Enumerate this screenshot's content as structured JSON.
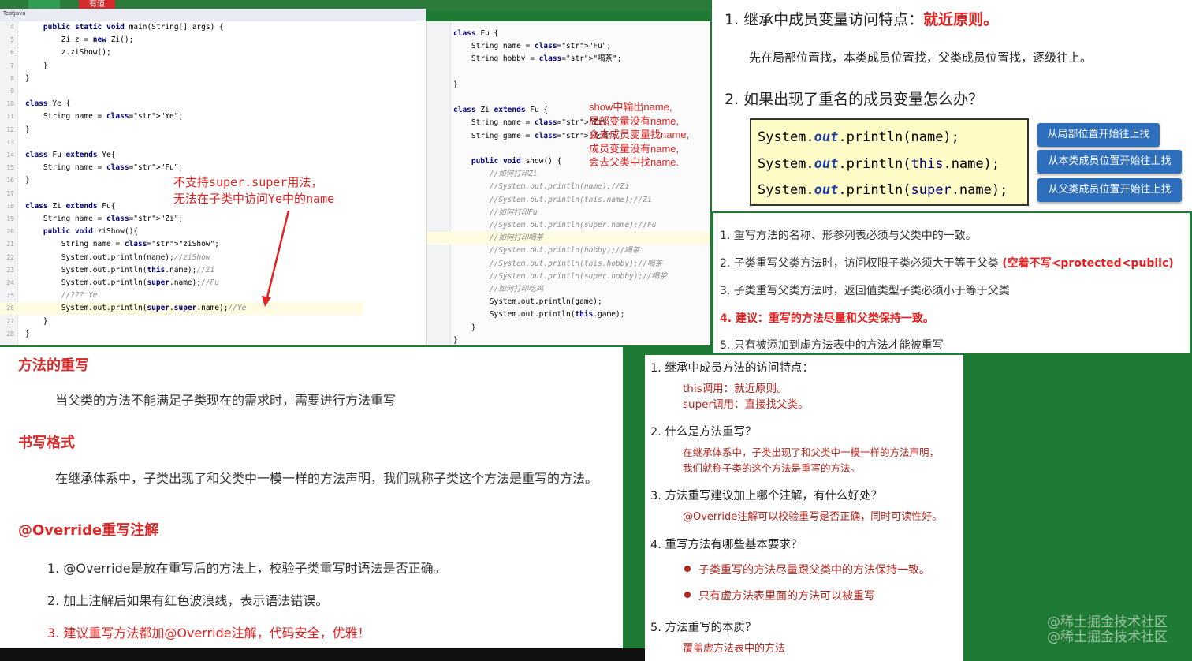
{
  "header": {
    "file_tab": "TestJava",
    "badge": "有道"
  },
  "left_code": {
    "lines": [
      {
        "n": "4",
        "t": "    public static void main(String[] args) {"
      },
      {
        "n": "5",
        "t": "        Zi z = new Zi();"
      },
      {
        "n": "6",
        "t": "        z.ziShow();"
      },
      {
        "n": "7",
        "t": "    }"
      },
      {
        "n": "8",
        "t": "}"
      },
      {
        "n": "9",
        "t": ""
      },
      {
        "n": "10",
        "t": "class Ye {"
      },
      {
        "n": "11",
        "t": "    String name = \"Ye\";"
      },
      {
        "n": "12",
        "t": "}"
      },
      {
        "n": "13",
        "t": ""
      },
      {
        "n": "14",
        "t": "class Fu extends Ye{"
      },
      {
        "n": "15",
        "t": "    String name = \"Fu\";"
      },
      {
        "n": "16",
        "t": "}"
      },
      {
        "n": "17",
        "t": ""
      },
      {
        "n": "18",
        "t": "class Zi extends Fu{"
      },
      {
        "n": "19",
        "t": "    String name = \"Zi\";"
      },
      {
        "n": "20",
        "t": "    public void ziShow(){"
      },
      {
        "n": "21",
        "t": "        String name = \"ziShow\";"
      },
      {
        "n": "22",
        "t": "        System.out.println(name);//ziShow"
      },
      {
        "n": "23",
        "t": "        System.out.println(this.name);//Zi"
      },
      {
        "n": "24",
        "t": "        System.out.println(super.name);//Fu"
      },
      {
        "n": "25",
        "t": "        //??? Ye"
      },
      {
        "n": "26",
        "t": "        System.out.println(super.super.name);//Ye"
      },
      {
        "n": "27",
        "t": "    }"
      },
      {
        "n": "28",
        "t": "}"
      }
    ],
    "annotation_1": "不支持super.super用法，",
    "annotation_2": "无法在子类中访问Ye中的name"
  },
  "mid_code": {
    "lines": [
      {
        "t": "class Fu {"
      },
      {
        "t": "    String name = \"Fu\";"
      },
      {
        "t": "    String hobby = \"喝茶\";"
      },
      {
        "t": ""
      },
      {
        "t": "}"
      },
      {
        "t": ""
      },
      {
        "t": "class Zi extends Fu {"
      },
      {
        "t": "    String name = \"Zi\";"
      },
      {
        "t": "    String game = \"吃鸡\";"
      },
      {
        "t": ""
      },
      {
        "t": "    public void show() {"
      },
      {
        "t": "        //如何打印Zi"
      },
      {
        "t": "        //System.out.println(name);//Zi"
      },
      {
        "t": "        //System.out.println(this.name);//Zi"
      },
      {
        "t": "        //如何打印Fu"
      },
      {
        "t": "        //System.out.println(super.name);//Fu"
      },
      {
        "t": "        //如何打印喝茶"
      },
      {
        "t": "        //System.out.println(hobby);//喝茶"
      },
      {
        "t": "        //System.out.println(this.hobby);//喝茶"
      },
      {
        "t": "        //System.out.println(super.hobby);//喝茶"
      },
      {
        "t": "        //如何打印吃鸡"
      },
      {
        "t": "        System.out.println(game);"
      },
      {
        "t": "        System.out.println(this.game);"
      },
      {
        "t": "    }"
      },
      {
        "t": "}"
      }
    ],
    "note": [
      "show中输出name,",
      "局部变量没有name,",
      "会去成员变量找name,",
      "成员变量没有name,",
      "会去父类中找name."
    ]
  },
  "slide_top": {
    "h1_prefix": "1.  继承中成员变量访问特点：",
    "h1_red": "就近原则。",
    "p1": "先在局部位置找，本类成员位置找，父类成员位置找，逐级往上。",
    "h2": "2.  如果出现了重名的成员变量怎么办？",
    "code1_a": "System.",
    "code1_b": "out",
    "code1_c": ".println(name);",
    "code2_a": "System.",
    "code2_b": "out",
    "code2_c": ".println(",
    "code2_d": "this",
    "code2_e": ".name);",
    "code3_a": "System.",
    "code3_b": "out",
    "code3_c": ".println(",
    "code3_d": "super",
    "code3_e": ".name);",
    "btn1": "从局部位置开始往上找",
    "btn2": "从本类成员位置开始往上找",
    "btn3": "从父类成员位置开始往上找"
  },
  "slide_list": {
    "i1": "1.  重写方法的名称、形参列表必须与父类中的一致。",
    "i2": "2.  子类重写父类方法时，访问权限子类必须大于等于父类",
    "i2_red": "(空着不写<protected<public)",
    "i3": "3.  子类重写父类方法时，返回值类型子类必须小于等于父类",
    "i4": "4.  建议：重写的方法尽量和父类保持一致。",
    "i5": "5.  只有被添加到虚方法表中的方法才能被重写"
  },
  "slide_bl": {
    "h1": "方法的重写",
    "p1": "当父类的方法不能满足子类现在的需求时，需要进行方法重写",
    "h2": "书写格式",
    "p2": "在继承体系中，子类出现了和父类中一模一样的方法声明，我们就称子类这个方法是重写的方法。",
    "h3": "@Override重写注解",
    "l1": "1.  @Override是放在重写后的方法上，校验子类重写时语法是否正确。",
    "l2": "2.  加上注解后如果有红色波浪线，表示语法错误。",
    "l3": "3.  建议重写方法都加@Override注解，代码安全，优雅！"
  },
  "slide_br": {
    "q1": "1.  继承中成员方法的访问特点：",
    "a1a": "this调用：就近原则。",
    "a1b": "super调用：直接找父类。",
    "q2": "2.  什么是方法重写？",
    "a2a": "在继承体系中，子类出现了和父类中一模一样的方法声明，",
    "a2b": "我们就称子类的这个方法是重写的方法。",
    "q3": "3.  方法重写建议加上哪个注解，有什么好处？",
    "a3": "@Override注解可以校验重写是否正确，同时可读性好。",
    "q4": "4.  重写方法有哪些基本要求？",
    "b1": "子类重写的方法尽量跟父类中的方法保持一致。",
    "b2": "只有虚方法表里面的方法可以被重写",
    "q5": "5.  方法重写的本质？",
    "a5": "覆盖虚方法表中的方法"
  },
  "watermark": {
    "w1": "@稀土掘金技术社区",
    "w2": "@稀土掘金技术社区"
  }
}
